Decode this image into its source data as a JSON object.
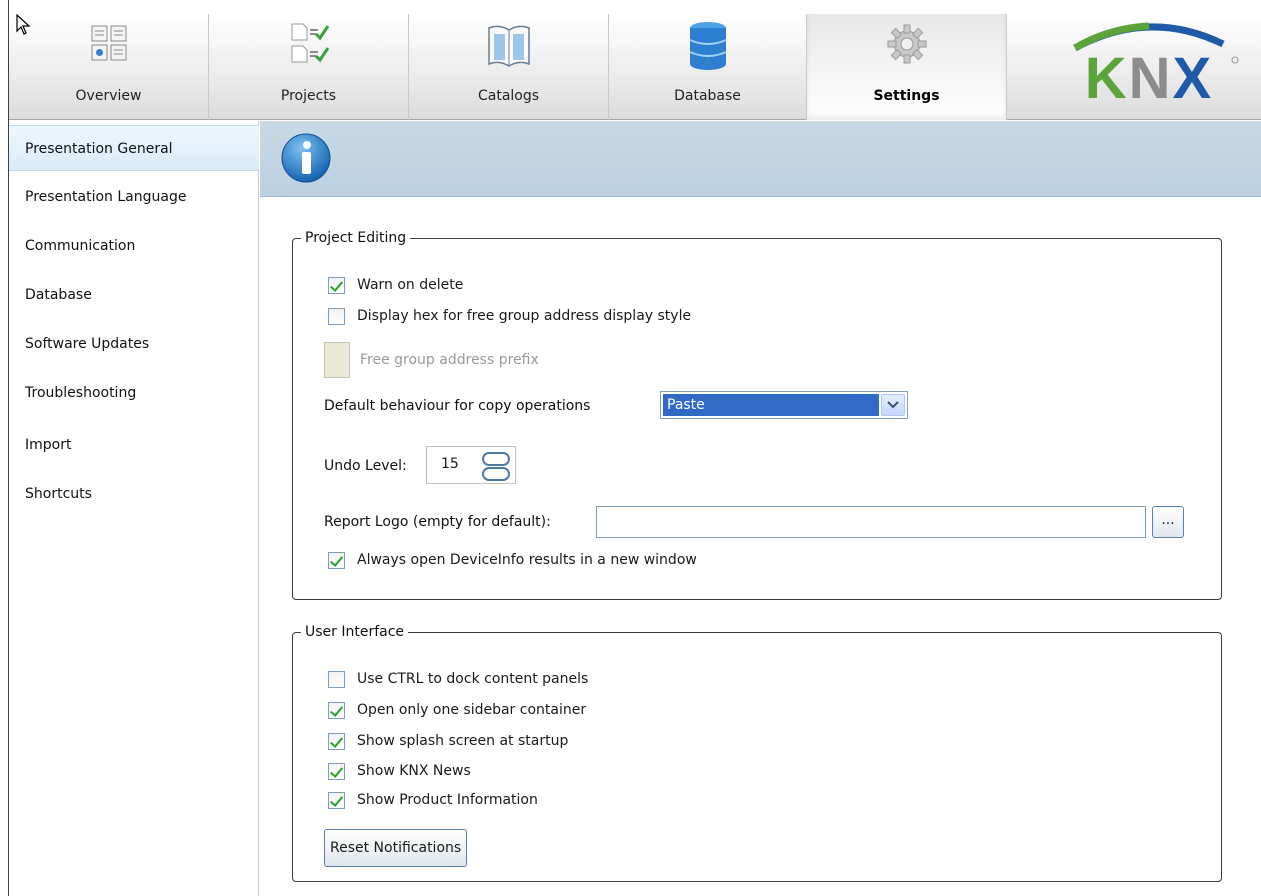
{
  "toolbar": {
    "tabs": [
      {
        "label": "Overview",
        "icon": "overview-icon"
      },
      {
        "label": "Projects",
        "icon": "projects-icon"
      },
      {
        "label": "Catalogs",
        "icon": "catalogs-icon"
      },
      {
        "label": "Database",
        "icon": "database-icon"
      },
      {
        "label": "Settings",
        "icon": "gear-icon",
        "active": true
      }
    ],
    "logo_text": "KNX"
  },
  "sidebar": {
    "items": [
      {
        "label": "Presentation General",
        "active": true
      },
      {
        "label": "Presentation Language"
      },
      {
        "label": "Communication"
      },
      {
        "label": "Database"
      },
      {
        "label": "Software Updates"
      },
      {
        "label": "Troubleshooting"
      },
      {
        "label": "Import"
      },
      {
        "label": "Shortcuts"
      }
    ]
  },
  "project_editing": {
    "title": "Project Editing",
    "warn_on_delete": {
      "label": "Warn on delete",
      "checked": true
    },
    "display_hex": {
      "label": "Display hex for free group address display style",
      "checked": false
    },
    "free_prefix_label": "Free group address prefix",
    "copy_behaviour": {
      "label": "Default behaviour for copy operations",
      "value": "Paste"
    },
    "undo_level": {
      "label": "Undo Level:",
      "value": "15"
    },
    "report_logo": {
      "label": "Report Logo (empty for default):",
      "value": "",
      "browse_label": "..."
    },
    "open_deviceinfo": {
      "label": "Always open DeviceInfo results in a new window",
      "checked": true
    }
  },
  "user_interface": {
    "title": "User Interface",
    "options": [
      {
        "label": "Use CTRL to dock content panels",
        "checked": false
      },
      {
        "label": "Open only one sidebar container",
        "checked": true
      },
      {
        "label": "Show splash screen at startup",
        "checked": true
      },
      {
        "label": "Show KNX News",
        "checked": true
      },
      {
        "label": "Show Product Information",
        "checked": true
      }
    ],
    "reset_label": "Reset Notifications"
  },
  "colors": {
    "accent": "#3169c6",
    "knx_green": "#5aa43a",
    "knx_blue": "#1e5aa8",
    "header_bg": "#c9d9e6"
  }
}
